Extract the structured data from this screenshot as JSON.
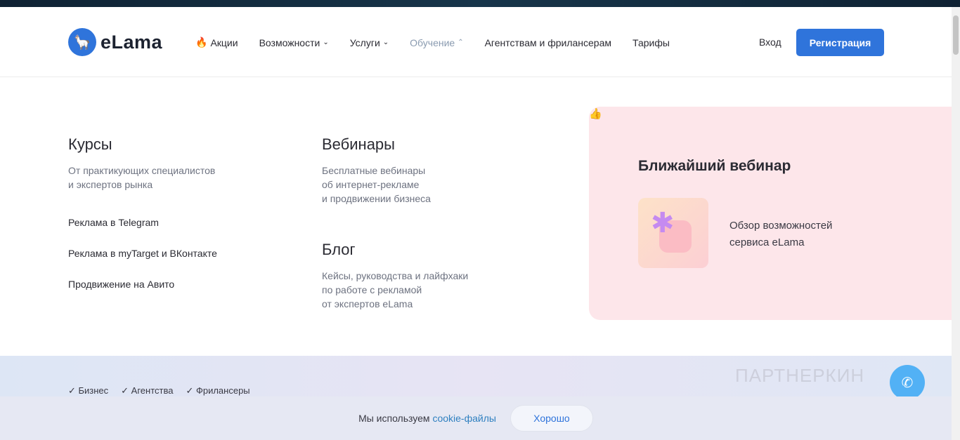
{
  "header": {
    "logo_text": "eLama",
    "nav": [
      {
        "label": "Акции"
      },
      {
        "label": "Возможности"
      },
      {
        "label": "Услуги"
      },
      {
        "label": "Обучение"
      },
      {
        "label": "Агентствам и фрилансерам"
      },
      {
        "label": "Тарифы"
      }
    ],
    "login": "Вход",
    "register": "Регистрация"
  },
  "menu": {
    "courses": {
      "title": "Курсы",
      "subtitle_lines": [
        "От практикующих специалистов",
        "и экспертов рынка"
      ],
      "links": [
        "Реклама в Telegram",
        "Реклама в myTarget и ВКонтакте",
        "Продвижение на Авито"
      ]
    },
    "webinars": {
      "title": "Вебинары",
      "subtitle_lines": [
        "Бесплатные вебинары",
        "об интернет-рекламе",
        "и продвижении бизнеса"
      ]
    },
    "blog": {
      "title": "Блог",
      "subtitle_lines": [
        "Кейсы, руководства и лайфхаки",
        "по работе с рекламой",
        "от экспертов eLama"
      ]
    },
    "card": {
      "title": "Ближайший вебинар",
      "text_lines": [
        "Обзор возможностей",
        "сервиса eLama"
      ]
    }
  },
  "bottom": {
    "checks": [
      "✓ Бизнес",
      "✓ Агентства",
      "✓ Фрилансеры"
    ]
  },
  "cookie": {
    "text": "Мы используем ",
    "link": "cookie-файлы",
    "ok": "Хорошо"
  },
  "watermark": "ПАРТНЕРКИН",
  "colors": {
    "accent": "#2f74db",
    "card_bg": "#fde6ea"
  }
}
